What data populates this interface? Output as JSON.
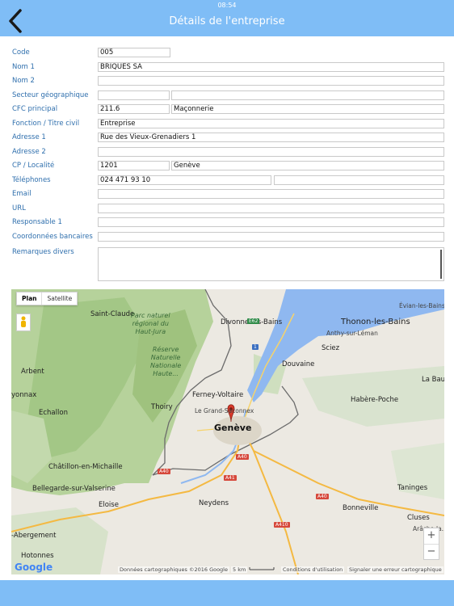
{
  "status": {
    "time": "08:54"
  },
  "nav": {
    "title": "Détails de l'entreprise"
  },
  "form": {
    "rows": [
      {
        "label": "Code",
        "values": [
          "005"
        ]
      },
      {
        "label": "Nom 1",
        "values": [
          "BRIQUES SA"
        ]
      },
      {
        "label": "Nom 2",
        "values": [
          ""
        ]
      },
      {
        "label": "Secteur géographique",
        "values": [
          "",
          ""
        ]
      },
      {
        "label": "CFC principal",
        "values": [
          "211.6",
          "Maçonnerie"
        ]
      },
      {
        "label": "Fonction / Titre civil",
        "values": [
          "Entreprise"
        ]
      },
      {
        "label": "Adresse 1",
        "values": [
          "Rue des Vieux-Grenadiers 1"
        ]
      },
      {
        "label": "Adresse 2",
        "values": [
          ""
        ]
      },
      {
        "label": "CP / Localité",
        "values": [
          "1201",
          "Genève"
        ]
      },
      {
        "label": "Téléphones",
        "values": [
          "024 471 93 10",
          ""
        ]
      },
      {
        "label": "Email",
        "values": [
          ""
        ]
      },
      {
        "label": "URL",
        "values": [
          ""
        ]
      },
      {
        "label": "Responsable 1",
        "values": [
          ""
        ]
      },
      {
        "label": "Coordonnées bancaires",
        "values": [
          ""
        ]
      },
      {
        "label": "Remarques divers",
        "values": [
          ""
        ]
      }
    ]
  },
  "map": {
    "type_control": {
      "plan": "Plan",
      "satellite": "Satellite"
    },
    "labels": {
      "saint_claude": "Saint-Claude",
      "parc": "Parc naturel\nrégional du\nHaut-Jura",
      "reserve": "Réserve\nNaturelle\nNationale\nHaute...",
      "divonne": "Divonne-les-Bains",
      "thonon": "Thonon-les-Bains",
      "evian": "Évian-les-Bains",
      "anthy": "Anthy-sur-Léman",
      "sciez": "Sciez",
      "douvaine": "Douvaine",
      "arbent": "Arbent",
      "oyonnax": "yonnax",
      "echallon": "Echallon",
      "ferney": "Ferney-Voltaire",
      "grand_saconnex": "Le Grand-Saconnex",
      "thoiry": "Thoiry",
      "geneve": "Genève",
      "habere": "Habère-Poche",
      "la_baume": "La Baume",
      "chatillon": "Châtillon-en-Michaille",
      "bellegarde": "Bellegarde-sur-Valserine",
      "neydens": "Neydens",
      "eloise": "Eloise",
      "taninges": "Taninges",
      "bonneville": "Bonneville",
      "cluses": "Cluses",
      "abergement": "-Abergement",
      "hotonnes": "Hotonnes",
      "arache": "Arâche-la..."
    },
    "roads": {
      "e62": "E62",
      "r1": "1",
      "a40_1": "A40",
      "a40_2": "A40",
      "a40_3": "A40",
      "a41": "A41",
      "a410": "A410"
    },
    "attribution": {
      "data": "Données cartographiques ©2016 Google",
      "scale": "5 km",
      "terms": "Conditions d'utilisation",
      "report": "Signaler une erreur cartographique"
    },
    "logo": "Google",
    "zoom_in": "+",
    "zoom_out": "−"
  },
  "colors": {
    "bar": "#7fbdf6",
    "label": "#2f6fad",
    "lake": "#8fb8f0",
    "forest": "#b8d7a0"
  }
}
